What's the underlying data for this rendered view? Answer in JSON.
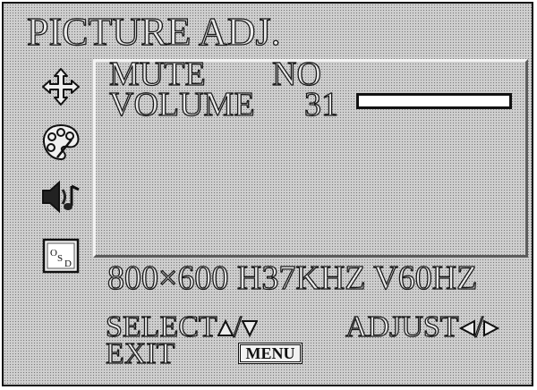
{
  "osd": {
    "title": "PICTURE ADJ.",
    "mute": {
      "label": "MUTE",
      "value": "NO"
    },
    "volume": {
      "label": "VOLUME",
      "value": "31",
      "level_fraction": 0
    },
    "resolution": "800×600 H37KHZ V60HZ",
    "footer": {
      "select_label": "SELECT",
      "select_separator": "/",
      "adjust_label": "ADJUST",
      "adjust_separator": "/",
      "exit_label": "EXIT",
      "menu_key": "MENU"
    }
  },
  "icons": [
    "move-arrows-icon",
    "palette-icon",
    "sound-icon",
    "osd-icon"
  ]
}
